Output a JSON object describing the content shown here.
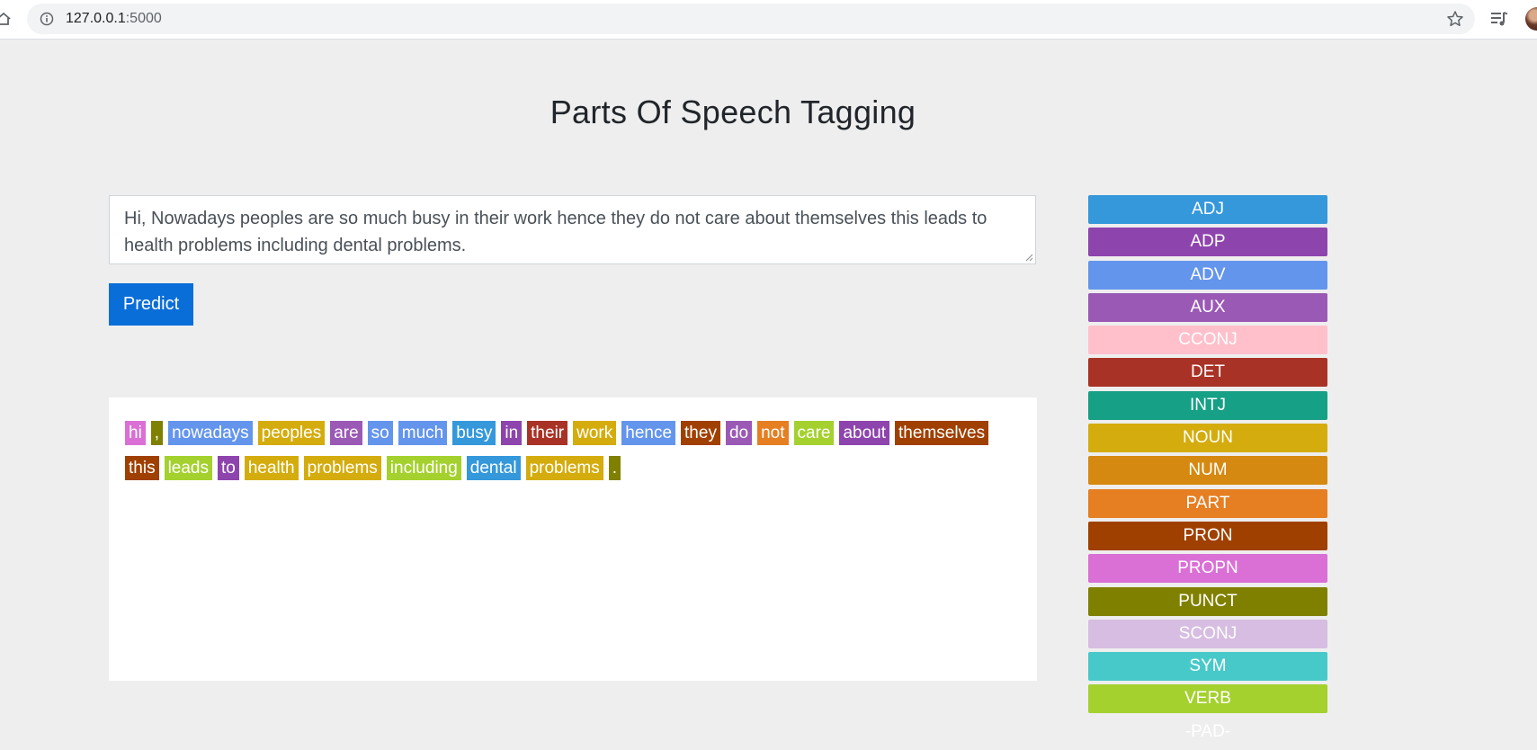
{
  "browser": {
    "url_host": "127.0.0.1",
    "url_port": ":5000"
  },
  "page": {
    "title": "Parts Of Speech Tagging",
    "input_text": "Hi, Nowadays peoples are so much busy in their work hence they do not care about themselves this leads to health problems including dental problems.",
    "predict_label": "Predict"
  },
  "tag_colors": {
    "ADJ": "#3498db",
    "ADP": "#8e44ad",
    "ADV": "#6495ed",
    "AUX": "#9b59b6",
    "CCONJ": "#ffc0cb",
    "DET": "#a93226",
    "INTJ": "#16a085",
    "NOUN": "#d4ac0d",
    "NUM": "#d68910",
    "PART": "#e67e22",
    "PRON": "#a04000",
    "PROPN": "#da70d6",
    "PUNCT": "#808000",
    "SCONJ": "#d7bde2",
    "SYM": "#48c9c9",
    "VERB": "#a4d12e",
    "-PAD-": "#ffffff"
  },
  "legend": [
    "ADJ",
    "ADP",
    "ADV",
    "AUX",
    "CCONJ",
    "DET",
    "INTJ",
    "NOUN",
    "NUM",
    "PART",
    "PRON",
    "PROPN",
    "PUNCT",
    "SCONJ",
    "SYM",
    "VERB",
    "-PAD-"
  ],
  "tokens": [
    {
      "text": "hi",
      "tag": "PROPN"
    },
    {
      "text": ",",
      "tag": "PUNCT"
    },
    {
      "text": "nowadays",
      "tag": "ADV"
    },
    {
      "text": "peoples",
      "tag": "NOUN"
    },
    {
      "text": "are",
      "tag": "AUX"
    },
    {
      "text": "so",
      "tag": "ADV"
    },
    {
      "text": "much",
      "tag": "ADV"
    },
    {
      "text": "busy",
      "tag": "ADJ"
    },
    {
      "text": "in",
      "tag": "ADP"
    },
    {
      "text": "their",
      "tag": "DET"
    },
    {
      "text": "work",
      "tag": "NOUN"
    },
    {
      "text": "hence",
      "tag": "ADV"
    },
    {
      "text": "they",
      "tag": "PRON"
    },
    {
      "text": "do",
      "tag": "AUX"
    },
    {
      "text": "not",
      "tag": "PART"
    },
    {
      "text": "care",
      "tag": "VERB"
    },
    {
      "text": "about",
      "tag": "ADP"
    },
    {
      "text": "themselves",
      "tag": "PRON"
    },
    {
      "text": "this",
      "tag": "PRON"
    },
    {
      "text": "leads",
      "tag": "VERB"
    },
    {
      "text": "to",
      "tag": "ADP"
    },
    {
      "text": "health",
      "tag": "NOUN"
    },
    {
      "text": "problems",
      "tag": "NOUN"
    },
    {
      "text": "including",
      "tag": "VERB"
    },
    {
      "text": "dental",
      "tag": "ADJ"
    },
    {
      "text": "problems",
      "tag": "NOUN"
    },
    {
      "text": ".",
      "tag": "PUNCT"
    }
  ]
}
